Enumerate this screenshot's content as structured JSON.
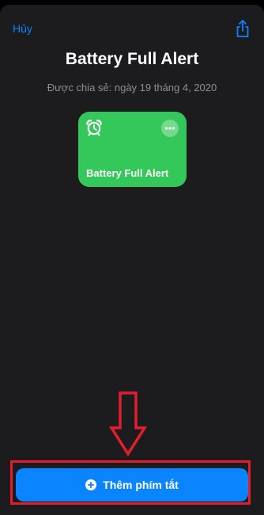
{
  "header": {
    "cancel_label": "Hủy",
    "share_icon": "share-icon"
  },
  "shortcut": {
    "title": "Battery Full Alert",
    "shared_date": "Được chia sẻ: ngày 19 tháng 4, 2020",
    "tile_label": "Battery Full Alert",
    "tile_icon": "alarm-clock-icon",
    "tile_color": "#34c759"
  },
  "action": {
    "add_label": "Thêm phím tắt",
    "add_icon": "plus-circle-icon",
    "button_color": "#0a84ff"
  },
  "annotation": {
    "arrow_icon": "down-arrow-icon",
    "highlight_color": "#e01e2d"
  },
  "colors": {
    "background": "#1c1c1e",
    "accent": "#0a84ff",
    "secondary_text": "#8e8e93"
  }
}
